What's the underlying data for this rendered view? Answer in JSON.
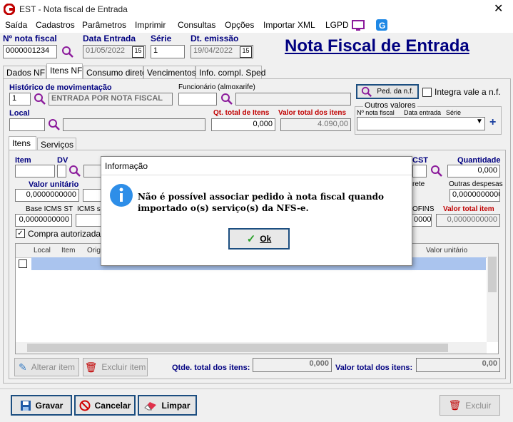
{
  "window": {
    "title": "EST - Nota fiscal de Entrada"
  },
  "menu": [
    "Saída",
    "Cadastros",
    "Parâmetros",
    "Imprimir",
    "Consultas",
    "Opções",
    "Importar XML",
    "LGPD"
  ],
  "header": {
    "nf_label": "Nº nota fiscal",
    "nf_value": "0000001234",
    "date_label": "Data Entrada",
    "date_value": "01/05/2022",
    "serie_label": "Série",
    "serie_value": "1",
    "emissao_label": "Dt. emissão",
    "emissao_value": "19/04/2022",
    "big_title": "Nota Fiscal de Entrada"
  },
  "tabs": [
    "Dados NF",
    "Itens NF",
    "Consumo direto",
    "Vencimentos",
    "Info. compl. Sped"
  ],
  "itens_nf": {
    "historico_label": "Histórico de movimentação",
    "historico_code": "1",
    "historico_desc": "ENTRADA POR NOTA FISCAL",
    "funcionario_label": "Funcionário (almoxarife)",
    "ped_button": "Ped. da n.f.",
    "integra_label": "Integra vale a n.f.",
    "local_label": "Local",
    "qt_total_label": "Qt. total de Itens",
    "qt_total_value": "0,000",
    "valor_total_label": "Valor total dos itens",
    "valor_total_value": "4.090,00",
    "outros_valores": {
      "legend": "Outros valores",
      "col1": "Nº nota fiscal",
      "col2": "Data entrada",
      "col3": "Série"
    }
  },
  "subtabs": [
    "Itens",
    "Serviços"
  ],
  "item_form": {
    "item_label": "Item",
    "dv_label": "DV",
    "cst_label": "CST",
    "quantidade_label": "Quantidade",
    "quantidade_value": "0,000",
    "valor_unitario_label": "Valor unitário",
    "valor_unitario_value": "0,0000000000",
    "frete_label": "rete",
    "outras_despesas_label": "Outras despesas",
    "outras_despesas_value": "0,0000000000",
    "base_icms_st_label": "Base ICMS ST",
    "base_icms_st_value": "0,0000000000",
    "icms_su_label": "ICMS su",
    "cofins_label": "OFINS",
    "cofins_value": "0000000",
    "valor_total_item_label": "Valor total item",
    "valor_total_item_value": "0,0000000000",
    "compra_autorizada": "Compra autorizada"
  },
  "grid": {
    "columns": [
      "Local",
      "Item",
      "Origi",
      "Valor unitário"
    ]
  },
  "item_buttons": {
    "alterar": "Alterar item",
    "excluir": "Excluir item"
  },
  "totals": {
    "qtde_label": "Qtde. total dos itens:",
    "qtde_value": "0,000",
    "valor_label": "Valor total dos itens:",
    "valor_value": "0,00"
  },
  "footer_buttons": {
    "gravar": "Gravar",
    "cancelar": "Cancelar",
    "limpar": "Limpar",
    "excluir": "Excluir"
  },
  "dialog": {
    "title": "Informação",
    "message": "Não é possível associar pedido à nota fiscal quando importado o(s) serviço(s) da NFS-e.",
    "ok": "Ok"
  }
}
